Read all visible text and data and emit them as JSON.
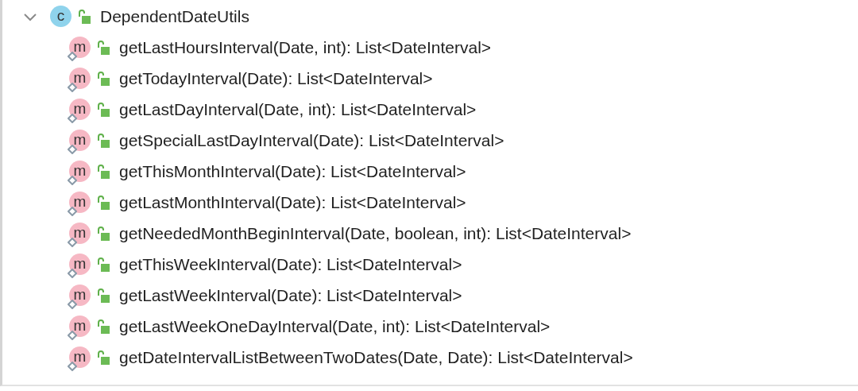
{
  "tree": {
    "kind": "class",
    "icon_letter": "c",
    "label": "DependentDateUtils",
    "expanded": true,
    "children": [
      {
        "kind": "method",
        "icon_letter": "m",
        "label": "getLastHoursInterval(Date, int): List<DateInterval>"
      },
      {
        "kind": "method",
        "icon_letter": "m",
        "label": "getTodayInterval(Date): List<DateInterval>"
      },
      {
        "kind": "method",
        "icon_letter": "m",
        "label": "getLastDayInterval(Date, int): List<DateInterval>"
      },
      {
        "kind": "method",
        "icon_letter": "m",
        "label": "getSpecialLastDayInterval(Date): List<DateInterval>"
      },
      {
        "kind": "method",
        "icon_letter": "m",
        "label": "getThisMonthInterval(Date): List<DateInterval>"
      },
      {
        "kind": "method",
        "icon_letter": "m",
        "label": "getLastMonthInterval(Date): List<DateInterval>"
      },
      {
        "kind": "method",
        "icon_letter": "m",
        "label": "getNeededMonthBeginInterval(Date, boolean, int): List<DateInterval>"
      },
      {
        "kind": "method",
        "icon_letter": "m",
        "label": "getThisWeekInterval(Date): List<DateInterval>"
      },
      {
        "kind": "method",
        "icon_letter": "m",
        "label": "getLastWeekInterval(Date): List<DateInterval>"
      },
      {
        "kind": "method",
        "icon_letter": "m",
        "label": "getLastWeekOneDayInterval(Date, int): List<DateInterval>"
      },
      {
        "kind": "method",
        "icon_letter": "m",
        "label": "getDateIntervalListBetweenTwoDates(Date, Date): List<DateInterval>"
      }
    ]
  }
}
